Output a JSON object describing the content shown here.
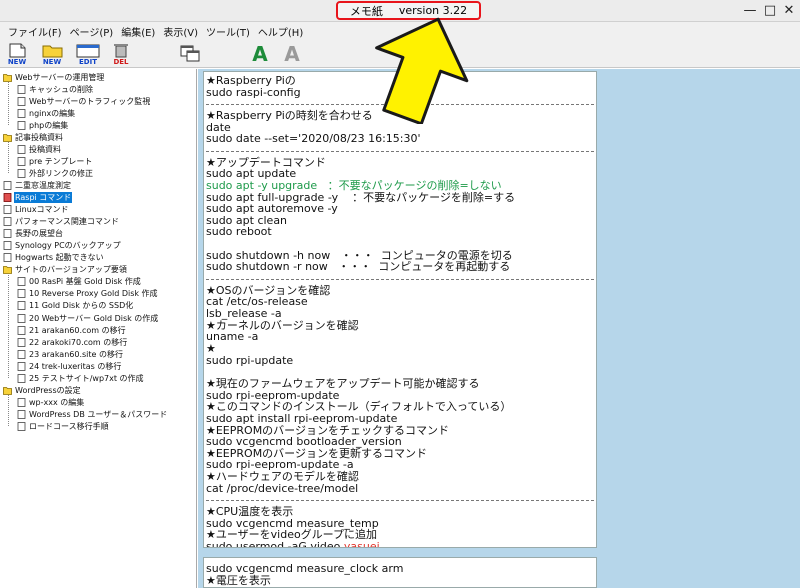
{
  "window": {
    "title": "メモ紙",
    "version": "version 3.22",
    "controls": {
      "minimize": "—",
      "maximize": "□",
      "close": "✕"
    }
  },
  "menu": [
    {
      "label": "ファイル(F)"
    },
    {
      "label": "ページ(P)"
    },
    {
      "label": "編集(E)"
    },
    {
      "label": "表示(V)"
    },
    {
      "label": "ツール(T)"
    },
    {
      "label": "ヘルプ(H)"
    }
  ],
  "toolbar": {
    "new_label": "NEW",
    "new2_label": "NEW",
    "edit_label": "EDIT",
    "del_label": "DEL",
    "font_glyph": "A",
    "font2_glyph": "A"
  },
  "tree": [
    {
      "label": "Webサーバーの運用管理",
      "type": "folder",
      "level": 0
    },
    {
      "label": "キャッシュの削除",
      "type": "page",
      "level": 1
    },
    {
      "label": "Webサーバーのトラフィック監視",
      "type": "page",
      "level": 1
    },
    {
      "label": "nginxの編集",
      "type": "page",
      "level": 1
    },
    {
      "label": "phpの編集",
      "type": "page",
      "level": 1
    },
    {
      "label": "記事投稿資料",
      "type": "folder",
      "level": 0
    },
    {
      "label": "投稿資料",
      "type": "page",
      "level": 1
    },
    {
      "label": "pre テンプレート",
      "type": "page",
      "level": 1
    },
    {
      "label": "外部リンクの修正",
      "type": "page",
      "level": 1
    },
    {
      "label": "二重窓温度測定",
      "type": "page",
      "level": 0
    },
    {
      "label": "Raspi コマンド",
      "type": "page",
      "level": 0,
      "selected": true
    },
    {
      "label": "Linuxコマンド",
      "type": "page",
      "level": 0
    },
    {
      "label": "パフォーマンス関連コマンド",
      "type": "page",
      "level": 0
    },
    {
      "label": "長野の展望台",
      "type": "page",
      "level": 0
    },
    {
      "label": "Synology PCのバックアップ",
      "type": "page",
      "level": 0
    },
    {
      "label": "Hogwarts 起動できない",
      "type": "page",
      "level": 0
    },
    {
      "label": "サイトのバージョンアップ要領",
      "type": "folder",
      "level": 0
    },
    {
      "label": "00 RasPi 基盤 Gold Disk 作成",
      "type": "page",
      "level": 1
    },
    {
      "label": "10 Reverse Proxy Gold Disk 作成",
      "type": "page",
      "level": 1
    },
    {
      "label": "11 Gold Disk からの SSD化",
      "type": "page",
      "level": 1
    },
    {
      "label": "20 Webサーバー Gold Disk の作成",
      "type": "page",
      "level": 1
    },
    {
      "label": "21 arakan60.com の移行",
      "type": "page",
      "level": 1
    },
    {
      "label": "22 arakoki70.com の移行",
      "type": "page",
      "level": 1
    },
    {
      "label": "23 arakan60.site の移行",
      "type": "page",
      "level": 1
    },
    {
      "label": "24 trek-luxeritas の移行",
      "type": "page",
      "level": 1
    },
    {
      "label": "25 テストサイト/wp7xt の作成",
      "type": "page",
      "level": 1
    },
    {
      "label": "WordPressの設定",
      "type": "folder",
      "level": 0
    },
    {
      "label": "wp-xxx の編集",
      "type": "page",
      "level": 1
    },
    {
      "label": "WordPress DB ユーザー＆パスワード",
      "type": "page",
      "level": 1
    },
    {
      "label": "ロードコース移行手順",
      "type": "page",
      "level": 1
    }
  ],
  "editor": {
    "lines": [
      {
        "t": "★Raspberry Piの"
      },
      {
        "t": "sudo raspi-config"
      },
      {
        "t": "",
        "sep": true
      },
      {
        "t": "★Raspberry Piの時刻を合わせる"
      },
      {
        "t": "date"
      },
      {
        "t": "sudo date --set='2020/08/23 16:15:30'"
      },
      {
        "t": "",
        "sep": true
      },
      {
        "t": "★アップデートコマンド"
      },
      {
        "t": "sudo apt update"
      },
      {
        "t": "sudo apt -y upgrade   ：不要なパッケージの削除=しない",
        "green": true
      },
      {
        "t": "sudo apt full-upgrade -y    ：不要なパッケージを削除=する"
      },
      {
        "t": "sudo apt autoremove -y"
      },
      {
        "t": "sudo apt clean"
      },
      {
        "t": "sudo reboot"
      },
      {
        "t": ""
      },
      {
        "t": "sudo shutdown -h now   ・・・  コンピュータの電源を切る"
      },
      {
        "t": "sudo shutdown -r now   ・・・  コンピュータを再起動する"
      },
      {
        "t": "",
        "sep": true
      },
      {
        "t": "★OSのバージョンを確認"
      },
      {
        "t": "cat /etc/os-release"
      },
      {
        "t": "lsb_release -a"
      },
      {
        "t": "★カーネルのバージョンを確認"
      },
      {
        "t": "uname -a"
      },
      {
        "t": "★"
      },
      {
        "t": "sudo rpi-update"
      },
      {
        "t": ""
      },
      {
        "t": "★現在のファームウェアをアップデート可能か確認する"
      },
      {
        "t": "sudo rpi-eeprom-update"
      },
      {
        "t": "★このコマンドのインストール（ディフォルトで入っている）"
      },
      {
        "t": "sudo apt install rpi-eeprom-update"
      },
      {
        "t": "★EEPROMのバージョンをチェックするコマンド"
      },
      {
        "t": "sudo vcgencmd bootloader_version"
      },
      {
        "t": "★EEPROMのバージョンを更新するコマンド"
      },
      {
        "t": "sudo rpi-eeprom-update -a"
      },
      {
        "t": "★ハードウェアのモデルを確認"
      },
      {
        "t": "cat /proc/device-tree/model"
      },
      {
        "t": "",
        "sep": true
      },
      {
        "t": "★CPU温度を表示"
      },
      {
        "t": "sudo vcgencmd measure_temp"
      },
      {
        "t": "★ユーザーをvideoグループに追加"
      },
      {
        "t": "sudo usermod -aG video "
      },
      {
        "t": ""
      }
    ],
    "partial_user": "yasuei"
  },
  "editor2": {
    "lines": [
      {
        "t": "sudo vcgencmd measure_clock arm"
      },
      {
        "t": "★電圧を表示"
      }
    ]
  }
}
